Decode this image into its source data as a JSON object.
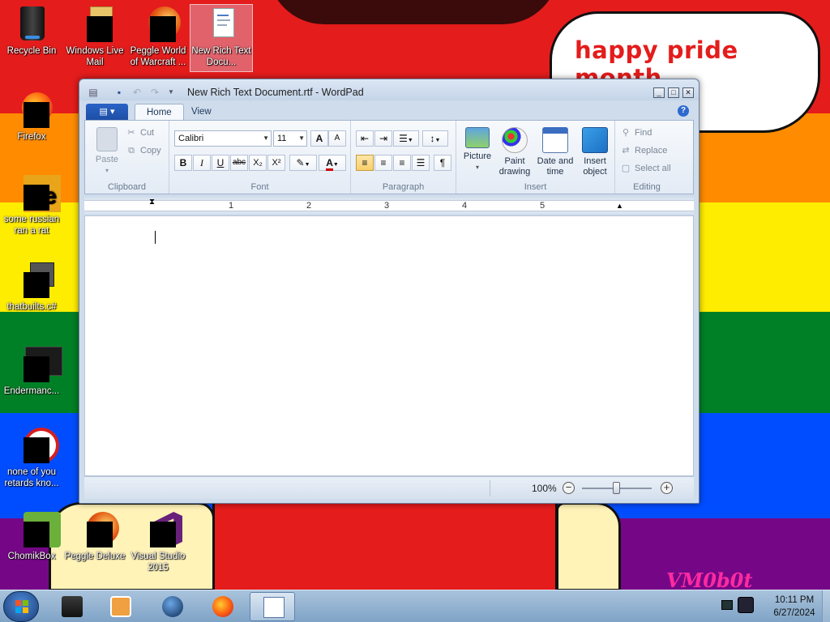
{
  "desktop": {
    "bubble_text": "happy pride month",
    "signature": "VM0b0t",
    "icons": [
      {
        "label": "Recycle Bin"
      },
      {
        "label": "Windows Live Mail"
      },
      {
        "label": "Peggle World of Warcraft ..."
      },
      {
        "label": "New Rich Text Docu..."
      },
      {
        "label": "Firefox"
      },
      {
        "label": "some russian ran a rat"
      },
      {
        "label": "thatbuilts.c#"
      },
      {
        "label": "Endermanc..."
      },
      {
        "label": "none of you retards kno..."
      },
      {
        "label": "ChomikBox"
      },
      {
        "label": "Peggle Deluxe"
      },
      {
        "label": "Visual Studio 2015"
      }
    ]
  },
  "wordpad": {
    "title": "New Rich Text Document.rtf - WordPad",
    "tabs": {
      "home": "Home",
      "view": "View"
    },
    "clipboard": {
      "paste": "Paste",
      "cut": "Cut",
      "copy": "Copy",
      "label": "Clipboard"
    },
    "font": {
      "family": "Calibri",
      "size": "11",
      "label": "Font",
      "bold": "B",
      "italic": "I",
      "underline": "U",
      "strike": "abc",
      "sub": "X₂",
      "sup": "X²",
      "grow": "A",
      "shrink": "A"
    },
    "paragraph": {
      "label": "Paragraph"
    },
    "insert": {
      "picture": "Picture",
      "paint_1": "Paint",
      "paint_2": "drawing",
      "date_1": "Date and",
      "date_2": "time",
      "object_1": "Insert",
      "object_2": "object",
      "label": "Insert"
    },
    "editing": {
      "find": "Find",
      "replace": "Replace",
      "select_all": "Select all",
      "label": "Editing"
    },
    "ruler": [
      "1",
      "2",
      "3",
      "4",
      "5"
    ],
    "zoom": {
      "level": "100%",
      "minus": "−",
      "plus": "+"
    }
  },
  "taskbar": {
    "time": "10:11 PM",
    "date": "6/27/2024"
  },
  "colors": {
    "accent": "#2b63c6",
    "bubble_text": "#e41c1c"
  }
}
